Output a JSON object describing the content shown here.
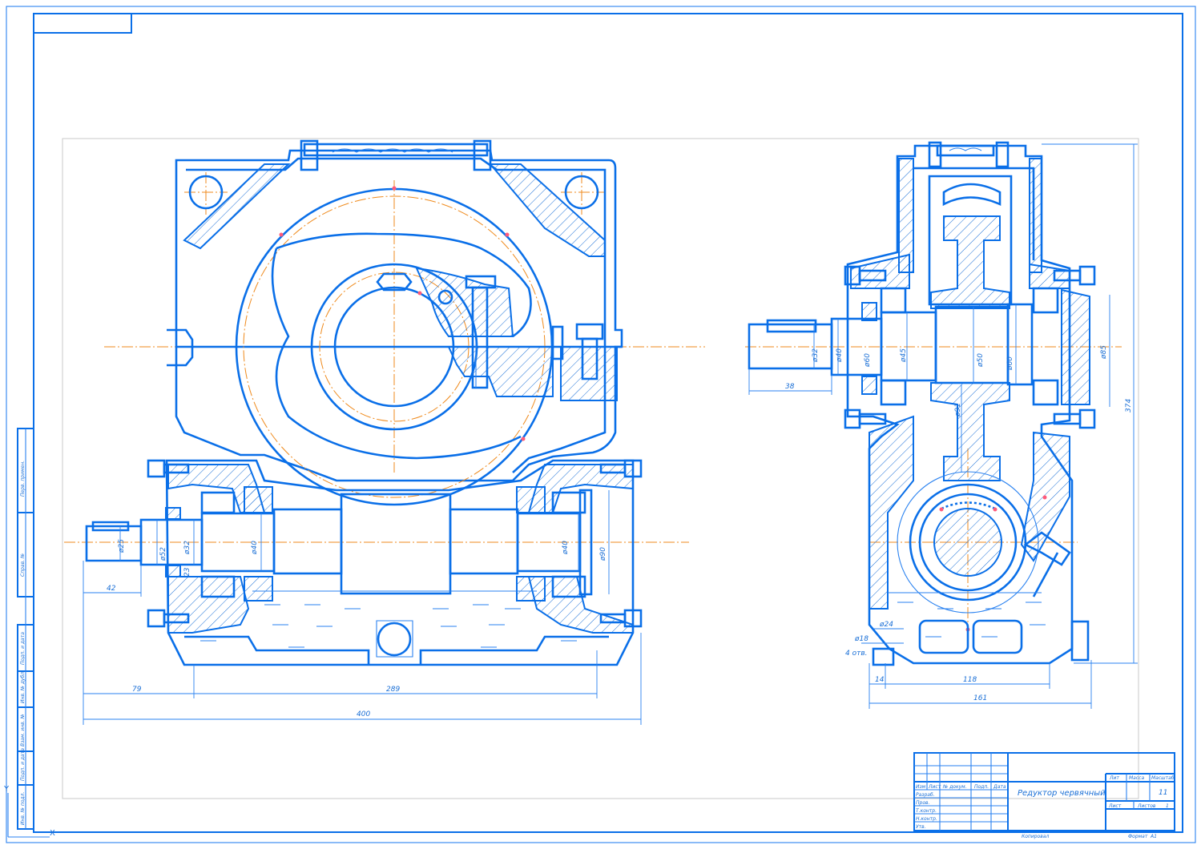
{
  "drawing": {
    "title": "Редуктор червячный",
    "sheet_number": "11",
    "sheets": "1",
    "format_label": "Формат",
    "format_value": "А1",
    "copied_label": "Копировал",
    "title_block_labels": {
      "izm": "Изм",
      "list": "Лист",
      "doc_no": "№ докум.",
      "sign": "Подп.",
      "date": "Дата",
      "developed": "Разраб.",
      "checked": "Пров.",
      "t_control": "Т.контр.",
      "n_control": "Н.контр.",
      "approved": "Утв.",
      "lit": "Лит",
      "mass": "Масса",
      "scale": "Масштаб",
      "sheet": "Лист",
      "sheets_label": "Листов"
    },
    "side_stamp": [
      "Перв. примен.",
      "Справ. №",
      "Подп. и дата",
      "Инв. № дубл.",
      "Взам. инв. №",
      "Подп. и дата",
      "Инв. № подл."
    ]
  },
  "front_view": {
    "dimensions": {
      "shaft_d": "ø25",
      "seal_d": "ø32",
      "bearing_seat_d": "ø52",
      "d40_left": "ø40",
      "d40_right": "ø40",
      "d90": "ø90",
      "d23": "23",
      "len_42": "42",
      "len_79": "79",
      "len_289": "289",
      "len_400": "400"
    }
  },
  "side_view": {
    "dimensions": {
      "d32": "ø32",
      "d40": "ø40",
      "d60_a": "ø60",
      "d45": "ø45",
      "d50": "ø50",
      "d60_b": "ø60",
      "d85": "ø85",
      "d91": "ø91",
      "len_38": "38",
      "height_374": "374",
      "d24": "ø24",
      "d18": "ø18",
      "holes": "4 отв.",
      "len_14": "14",
      "len_118": "118",
      "len_161": "161"
    }
  },
  "axes": {
    "y": "Y",
    "x": "X"
  },
  "colors": {
    "line": "#0a6fe8",
    "centerline": "#ef8a1c",
    "point": "#ff5a7a"
  }
}
